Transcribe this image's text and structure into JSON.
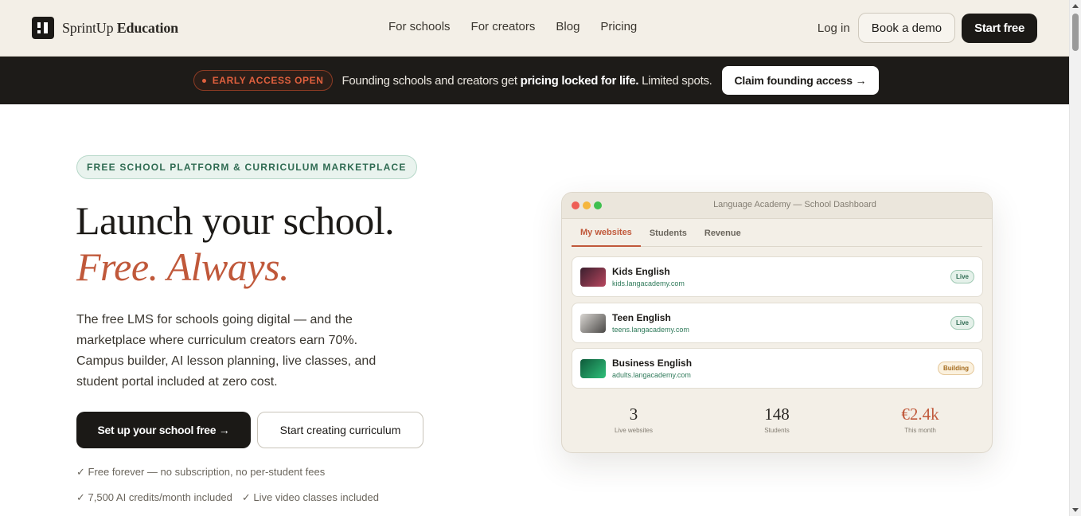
{
  "header": {
    "logo_light": "SprintUp",
    "logo_bold": "Education",
    "nav": [
      "For schools",
      "For creators",
      "Blog",
      "Pricing"
    ],
    "login": "Log in",
    "book_demo": "Book a demo",
    "start_free": "Start free"
  },
  "announce": {
    "badge": "EARLY ACCESS OPEN",
    "text_before": "Founding schools and creators get ",
    "text_bold": "pricing locked for life.",
    "text_after": " Limited spots.",
    "cta": "Claim founding access →"
  },
  "hero": {
    "badge": "FREE SCHOOL PLATFORM & CURRICULUM MARKETPLACE",
    "title_line1": "Launch your school.",
    "title_line2": "Free. Always.",
    "description": "The free LMS for schools going digital — and the marketplace where curriculum creators earn 70%. Campus builder, AI lesson planning, live classes, and student portal included at zero cost.",
    "cta_primary": "Set up your school free →",
    "cta_secondary": "Start creating curriculum",
    "perks": [
      "✓ Free forever — no subscription, no per-student fees",
      "✓ 7,500 AI credits/month included",
      "✓ Live video classes included"
    ]
  },
  "dashboard": {
    "window_title": "Language Academy — School Dashboard",
    "tabs": [
      "My websites",
      "Students",
      "Revenue"
    ],
    "sites": [
      {
        "name": "Kids English",
        "url": "kids.langacademy.com",
        "status": "Live"
      },
      {
        "name": "Teen English",
        "url": "teens.langacademy.com",
        "status": "Live"
      },
      {
        "name": "Business English",
        "url": "adults.langacademy.com",
        "status": "Building"
      }
    ],
    "stats": [
      {
        "value": "3",
        "label": "Live websites"
      },
      {
        "value": "148",
        "label": "Students"
      },
      {
        "value": "€2.4k",
        "label": "This month"
      }
    ]
  },
  "colors": {
    "accent": "#c0583a",
    "dark": "#1b1916",
    "cream": "#f3efe7",
    "green": "#2f6b52"
  }
}
